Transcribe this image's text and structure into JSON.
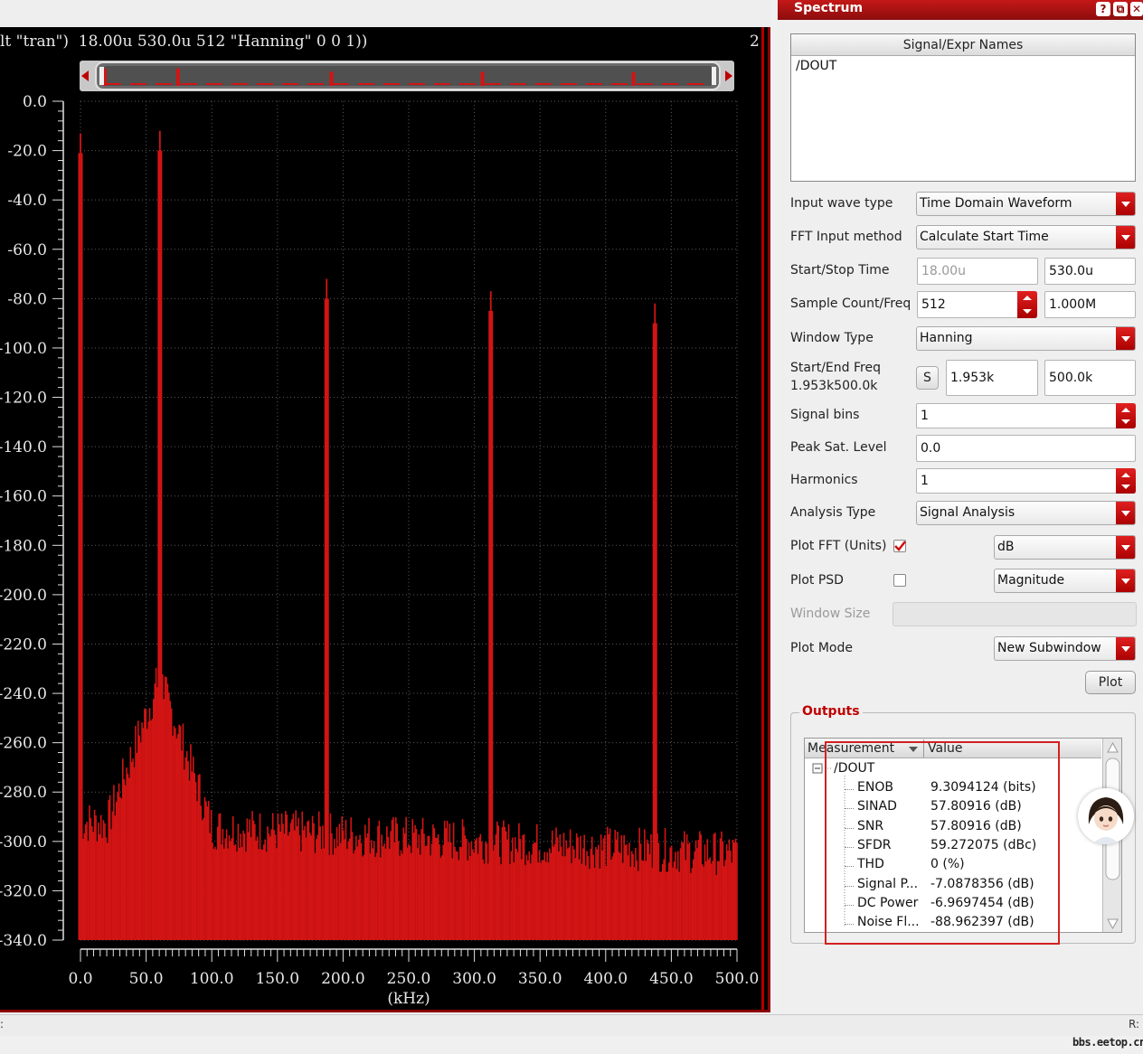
{
  "waveform": {
    "expression": "lt \"tran\")  18.00u 530.0u 512 \"Hanning\" 0 0 1))",
    "subwindow_number": "2"
  },
  "chart_data": {
    "type": "bar",
    "xlabel": "(kHz)",
    "ylabel": "",
    "xlim": [
      0,
      500
    ],
    "ylim": [
      -340,
      0
    ],
    "x_ticks": [
      "0.0",
      "50.0",
      "100.0",
      "150.0",
      "200.0",
      "250.0",
      "300.0",
      "350.0",
      "400.0",
      "450.0",
      "500.0"
    ],
    "y_ticks": [
      "0.0",
      "-20.0",
      "-40.0",
      "-60.0",
      "-80.0",
      "-100.0",
      "-120.0",
      "-140.0",
      "-160.0",
      "-180.0",
      "-200.0",
      "-220.0",
      "-240.0",
      "-260.0",
      "-280.0",
      "-300.0",
      "-320.0",
      "-340.0"
    ],
    "grid": true,
    "bin_spacing_khz": 1.953,
    "color": "#d21414",
    "peaks": [
      {
        "x": 0.0,
        "y": -13.0
      },
      {
        "x": 60.5,
        "y": -12.0
      },
      {
        "x": 187.5,
        "y": -72.0
      },
      {
        "x": 312.5,
        "y": -77.0
      },
      {
        "x": 437.5,
        "y": -82.0
      }
    ],
    "noise_floor_y": -292,
    "noise_floor_end_y": -305
  },
  "panel": {
    "title": "Spectrum",
    "title_buttons": [
      "?",
      "⧉",
      "✕"
    ],
    "signal_list_header": "Signal/Expr Names",
    "signal_list_items": [
      "/DOUT"
    ],
    "input_wave_type": {
      "label": "Input wave type",
      "value": "Time Domain Waveform"
    },
    "fft_input_method": {
      "label": "FFT Input method",
      "value": "Calculate Start Time"
    },
    "start_stop_time": {
      "label": "Start/Stop Time",
      "start": "18.00u",
      "stop": "530.0u"
    },
    "sample_count": {
      "label": "Sample Count/Freq",
      "count": "512",
      "freq": "1.000M"
    },
    "window_type": {
      "label": "Window Type",
      "value": "Hanning"
    },
    "start_end_freq": {
      "label": "Start/End Freq",
      "sublabel": "1.953k500.0k",
      "button": "S",
      "start": "1.953k",
      "end": "500.0k"
    },
    "signal_bins": {
      "label": "Signal bins",
      "value": "1"
    },
    "peak_sat_level": {
      "label": "Peak Sat. Level",
      "value": "0.0"
    },
    "harmonics": {
      "label": "Harmonics",
      "value": "1"
    },
    "analysis_type": {
      "label": "Analysis Type",
      "value": "Signal Analysis"
    },
    "plot_fft": {
      "label": "Plot FFT (Units)",
      "checked": true,
      "value": "dB"
    },
    "plot_psd": {
      "label": "Plot PSD",
      "checked": false,
      "value": "Magnitude"
    },
    "window_size": {
      "label": "Window Size",
      "value": ""
    },
    "plot_mode": {
      "label": "Plot Mode",
      "value": "New Subwindow"
    },
    "plot_button": "Plot"
  },
  "outputs": {
    "title": "Outputs",
    "columns": [
      "Measurement",
      "Value"
    ],
    "root": "/DOUT",
    "rows": [
      {
        "name": "ENOB",
        "value": "9.3094124 (bits)"
      },
      {
        "name": "SINAD",
        "value": "57.80916 (dB)"
      },
      {
        "name": "SNR",
        "value": "57.80916 (dB)"
      },
      {
        "name": "SFDR",
        "value": "59.272075 (dBc)"
      },
      {
        "name": "THD",
        "value": "0 (%)"
      },
      {
        "name": "Signal P...",
        "value": "-7.0878356 (dB)"
      },
      {
        "name": "DC Power",
        "value": "-6.9697454 (dB)"
      },
      {
        "name": "Noise Fl...",
        "value": "-88.962397 (dB)"
      }
    ]
  },
  "statusbar": {
    "left": ":",
    "right": "R:"
  },
  "watermark": "bbs.eetop.cn"
}
